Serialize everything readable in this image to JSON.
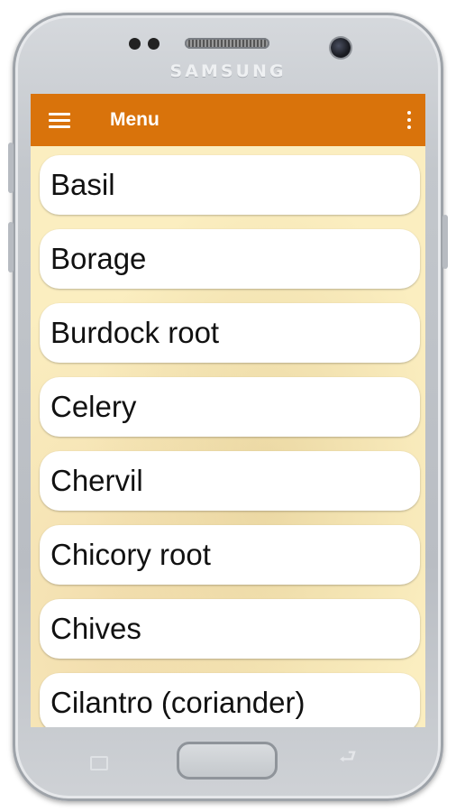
{
  "device": {
    "brand": "SAMSUNG"
  },
  "app_bar": {
    "title": "Menu",
    "background_color": "#d9730b",
    "menu_icon": "hamburger-menu-icon",
    "overflow_icon": "more-vertical-icon"
  },
  "list": {
    "items": [
      {
        "label": "Basil"
      },
      {
        "label": "Borage"
      },
      {
        "label": "Burdock root"
      },
      {
        "label": "Celery"
      },
      {
        "label": "Chervil"
      },
      {
        "label": "Chicory root"
      },
      {
        "label": "Chives"
      },
      {
        "label": "Cilantro (coriander)"
      }
    ]
  },
  "nav_keys": {
    "recent_icon": "recent-apps-icon",
    "home_icon": "home-button",
    "back_icon": "back-icon"
  }
}
